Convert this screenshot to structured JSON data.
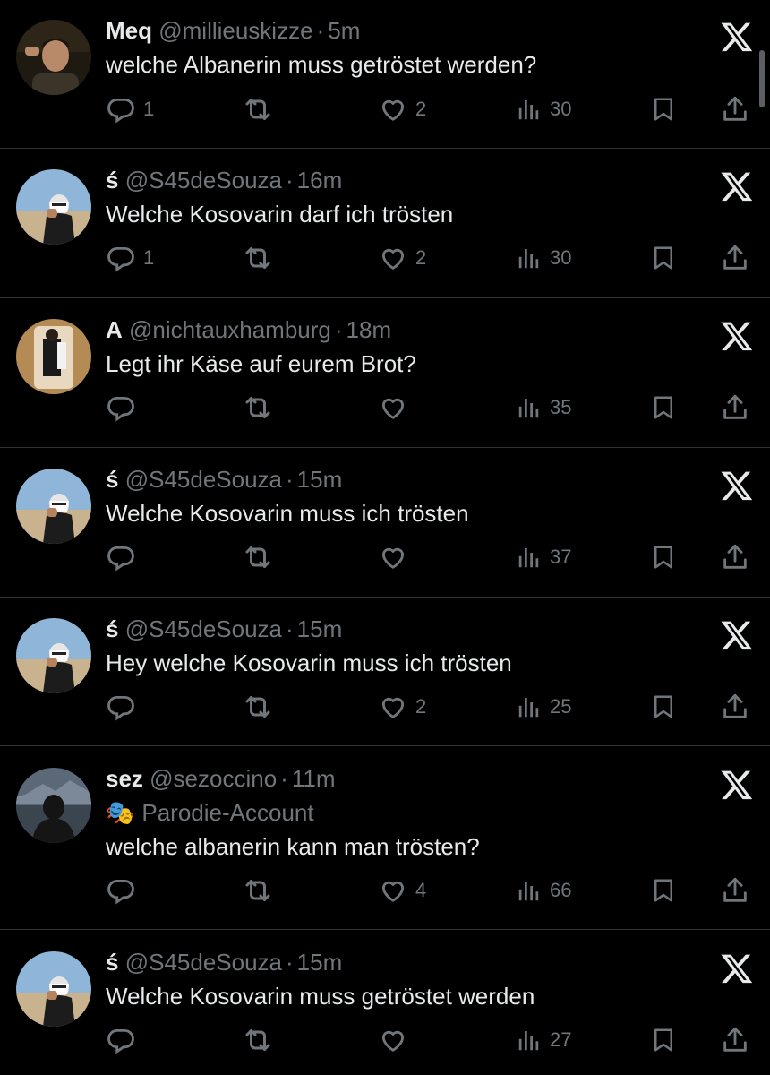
{
  "tweets": [
    {
      "name": "Meq",
      "handle": "@millieuskizze",
      "sep": "·",
      "time": "5m",
      "badge": "",
      "text": "welche Albanerin muss getröstet werden?",
      "replies": "1",
      "retweets": "",
      "likes": "2",
      "views": "30",
      "avatar": "selfie"
    },
    {
      "name": "ś",
      "handle": "@S45deSouza",
      "sep": "·",
      "time": "16m",
      "badge": "",
      "text": "Welche Kosovarin darf ich trösten",
      "replies": "1",
      "retweets": "",
      "likes": "2",
      "views": "30",
      "avatar": "desert"
    },
    {
      "name": "A",
      "handle": "@nichtauxhamburg",
      "sep": "·",
      "time": "18m",
      "badge": "",
      "text": "Legt ihr Käse auf eurem Brot?",
      "replies": "",
      "retweets": "",
      "likes": "",
      "views": "35",
      "avatar": "mirror"
    },
    {
      "name": "ś",
      "handle": "@S45deSouza",
      "sep": "·",
      "time": "15m",
      "badge": "",
      "text": "Welche Kosovarin muss ich trösten",
      "replies": "",
      "retweets": "",
      "likes": "",
      "views": "37",
      "avatar": "desert"
    },
    {
      "name": "ś",
      "handle": "@S45deSouza",
      "sep": "·",
      "time": "15m",
      "badge": "",
      "text": "Hey welche Kosovarin muss ich trösten",
      "replies": "",
      "retweets": "",
      "likes": "2",
      "views": "25",
      "avatar": "desert"
    },
    {
      "name": "sez",
      "handle": "@sezoccino",
      "sep": "·",
      "time": "11m",
      "badge": "Parodie-Account",
      "text": "welche albanerin kann man trösten?",
      "replies": "",
      "retweets": "",
      "likes": "4",
      "views": "66",
      "avatar": "hooded"
    },
    {
      "name": "ś",
      "handle": "@S45deSouza",
      "sep": "·",
      "time": "15m",
      "badge": "",
      "text": "Welche Kosovarin muss getröstet werden",
      "replies": "",
      "retweets": "",
      "likes": "",
      "views": "27",
      "avatar": "desert"
    }
  ],
  "icons": {
    "reply": "reply-icon",
    "retweet": "retweet-icon",
    "like": "heart-icon",
    "views": "views-icon",
    "bookmark": "bookmark-icon",
    "share": "share-icon",
    "brand": "x-logo-icon",
    "badge": "parody-mask-icon"
  },
  "colors": {
    "background": "#000000",
    "text": "#e7e9ea",
    "muted": "#71767b",
    "divider": "#2f3336"
  }
}
